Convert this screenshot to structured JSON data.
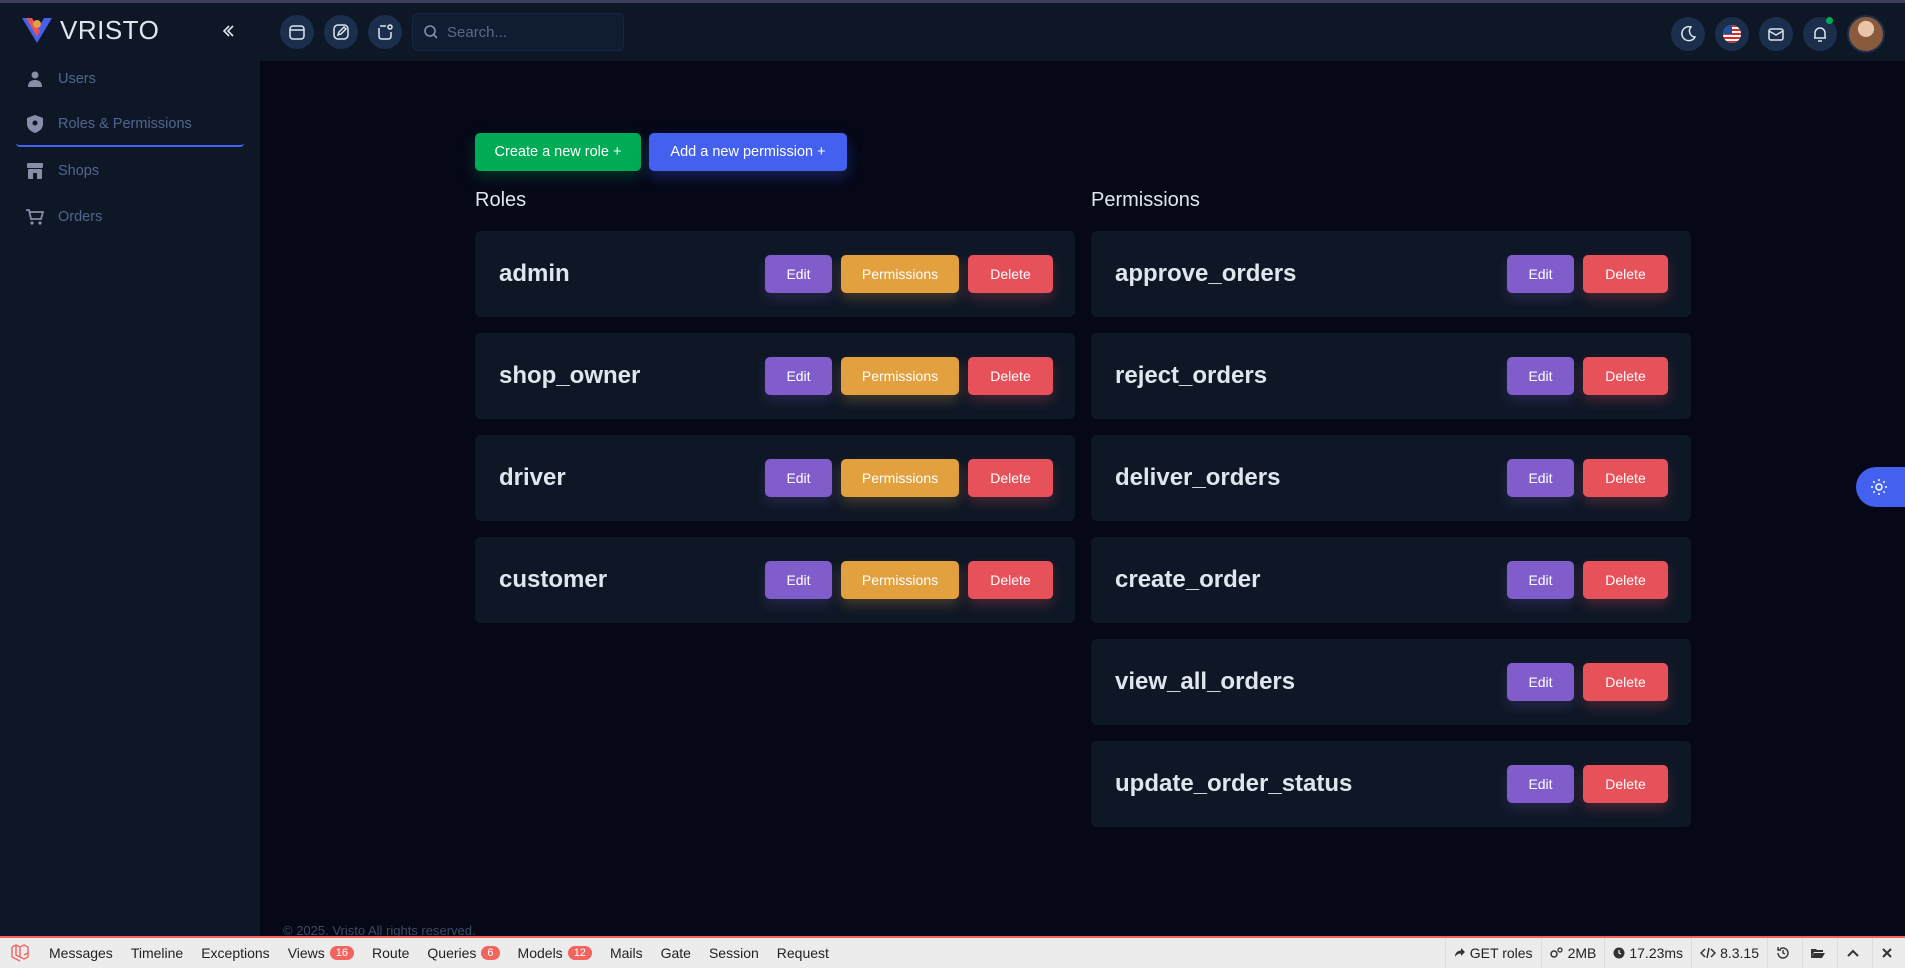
{
  "app": {
    "name": "VRISTO"
  },
  "sidebar": {
    "items": [
      {
        "label": "Users",
        "icon": "user-icon"
      },
      {
        "label": "Roles & Permissions",
        "icon": "shield-icon"
      },
      {
        "label": "Shops",
        "icon": "store-icon"
      },
      {
        "label": "Orders",
        "icon": "cart-icon"
      }
    ]
  },
  "header": {
    "search_placeholder": "Search..."
  },
  "toolbar": {
    "create_role_label": "Create a new role +",
    "add_permission_label": "Add a new permission +"
  },
  "roles": {
    "title": "Roles",
    "items": [
      {
        "name": "admin"
      },
      {
        "name": "shop_owner"
      },
      {
        "name": "driver"
      },
      {
        "name": "customer"
      }
    ]
  },
  "permissions": {
    "title": "Permissions",
    "items": [
      {
        "name": "approve_orders"
      },
      {
        "name": "reject_orders"
      },
      {
        "name": "deliver_orders"
      },
      {
        "name": "create_order"
      },
      {
        "name": "view_all_orders"
      },
      {
        "name": "update_order_status"
      }
    ]
  },
  "card_buttons": {
    "edit": "Edit",
    "permissions": "Permissions",
    "delete": "Delete"
  },
  "footer": {
    "copyright": "© 2025. Vristo All rights reserved."
  },
  "debugbar": {
    "tabs": [
      {
        "label": "Messages",
        "badge": ""
      },
      {
        "label": "Timeline",
        "badge": ""
      },
      {
        "label": "Exceptions",
        "badge": ""
      },
      {
        "label": "Views",
        "badge": "16"
      },
      {
        "label": "Route",
        "badge": ""
      },
      {
        "label": "Queries",
        "badge": "6"
      },
      {
        "label": "Models",
        "badge": "12"
      },
      {
        "label": "Mails",
        "badge": ""
      },
      {
        "label": "Gate",
        "badge": ""
      },
      {
        "label": "Session",
        "badge": ""
      },
      {
        "label": "Request",
        "badge": ""
      }
    ],
    "route": "GET roles",
    "memory": "2MB",
    "time": "17.23ms",
    "php_version": "8.3.15"
  },
  "colors": {
    "primary": "#4361ee",
    "success": "#00ab55",
    "secondary": "#805dca",
    "warning": "#e2a03f",
    "danger": "#e7515a"
  }
}
